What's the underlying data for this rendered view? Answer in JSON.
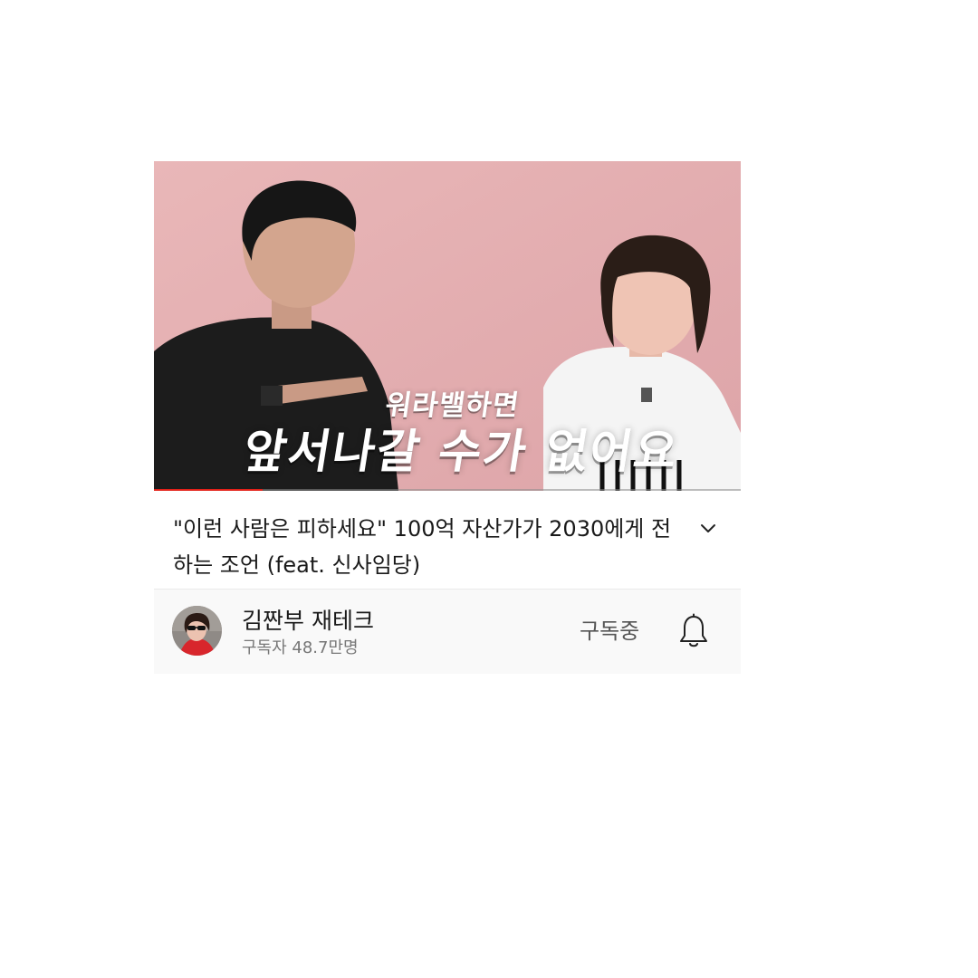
{
  "video": {
    "thumbnail_caption_small": "워라밸하면",
    "thumbnail_caption_big": "앞서나갈 수가 없어요",
    "progress": 0.185,
    "progress_color": "#e32119"
  },
  "title": "\"이런 사람은 피하세요\" 100억 자산가가 2030에게 전하는 조언 (feat. 신사임당)",
  "expand_icon": "chevron-down-icon",
  "channel": {
    "name": "김짠부 재테크",
    "subscribers": "구독자 48.7만명",
    "subscribe_state": "구독중",
    "bell_icon": "bell-icon"
  }
}
